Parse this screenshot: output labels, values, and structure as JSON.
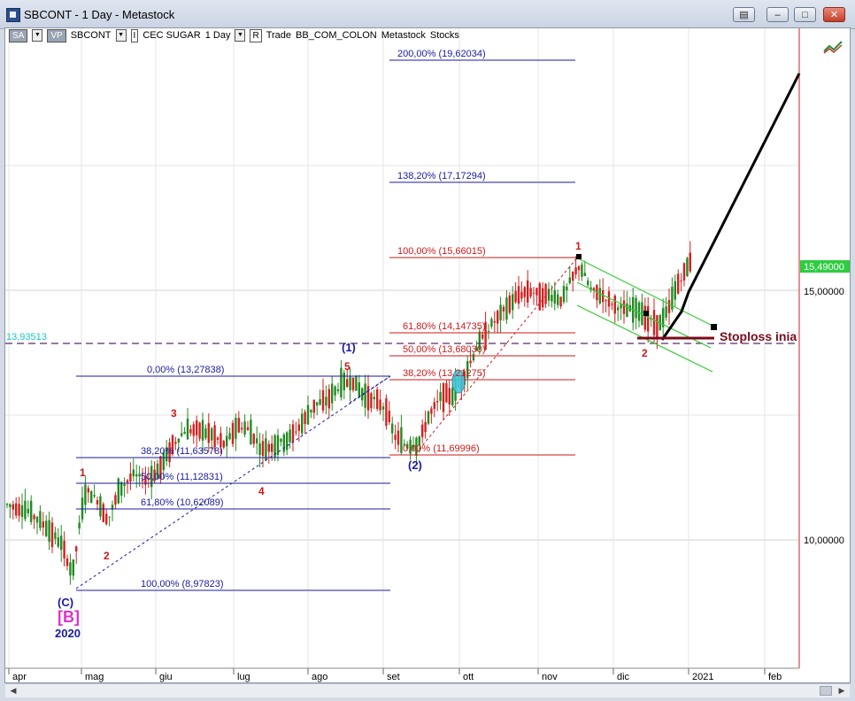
{
  "window": {
    "title": "SBCONT - 1 Day - Metastock",
    "buttons": {
      "extra": "▤",
      "minimize": "–",
      "maximize": "□",
      "close": "✕"
    }
  },
  "toolbar": {
    "sa": "SA",
    "vp": "VP",
    "symbol": "SBCONT",
    "i_box": "I",
    "security_name": "CEC SUGAR",
    "period": "1 Day",
    "r_box": "R",
    "trade": "Trade",
    "template": "BB_COM_COLON",
    "metastock": "Metastock",
    "stocks": "Stocks"
  },
  "price_axis": {
    "current_price": "15,49000",
    "ticks": [
      "15,00000",
      "10,00000"
    ],
    "reference_level": "13,93513"
  },
  "time_axis": {
    "labels": [
      "apr",
      "mag",
      "giu",
      "lug",
      "ago",
      "set",
      "ott",
      "nov",
      "dic",
      "2021",
      "feb"
    ]
  },
  "fib_left": [
    "0,00% (13,27838)",
    "38,20% (11,63578)",
    "50,00% (11,12831)",
    "61,80% (10,62089)",
    "100,00% (8,97823)"
  ],
  "fib_right_blue": [
    "200,00% (19,62034)",
    "138,20% (17,17294)"
  ],
  "fib_right_red": [
    "100,00% (15,66015)",
    "61,80% (14,14735)",
    "50,00% (13,68030)",
    "38,20% (13,21275)",
    "0,00% (11,69996)"
  ],
  "wave_labels": {
    "minor": [
      "1",
      "2",
      "3",
      "4",
      "5"
    ],
    "major_1": "(1)",
    "major_2": "(2)",
    "major_c": "(C)",
    "b_label": "[B]",
    "year": "2020",
    "right_1": "1",
    "right_2": "2"
  },
  "annotation": {
    "stoploss": "Stoploss inia"
  },
  "colors": {
    "up_candle": "#228b22",
    "down_candle": "#d42020",
    "fib_blue": "#1a1aa0",
    "fib_red": "#cc1a1a",
    "channel": "#33cc33",
    "projection": "#000000",
    "price_tag": "#2ecc40",
    "b_label": "#dd33cc"
  },
  "icons": {
    "tools": "chart-tools-icon"
  }
}
